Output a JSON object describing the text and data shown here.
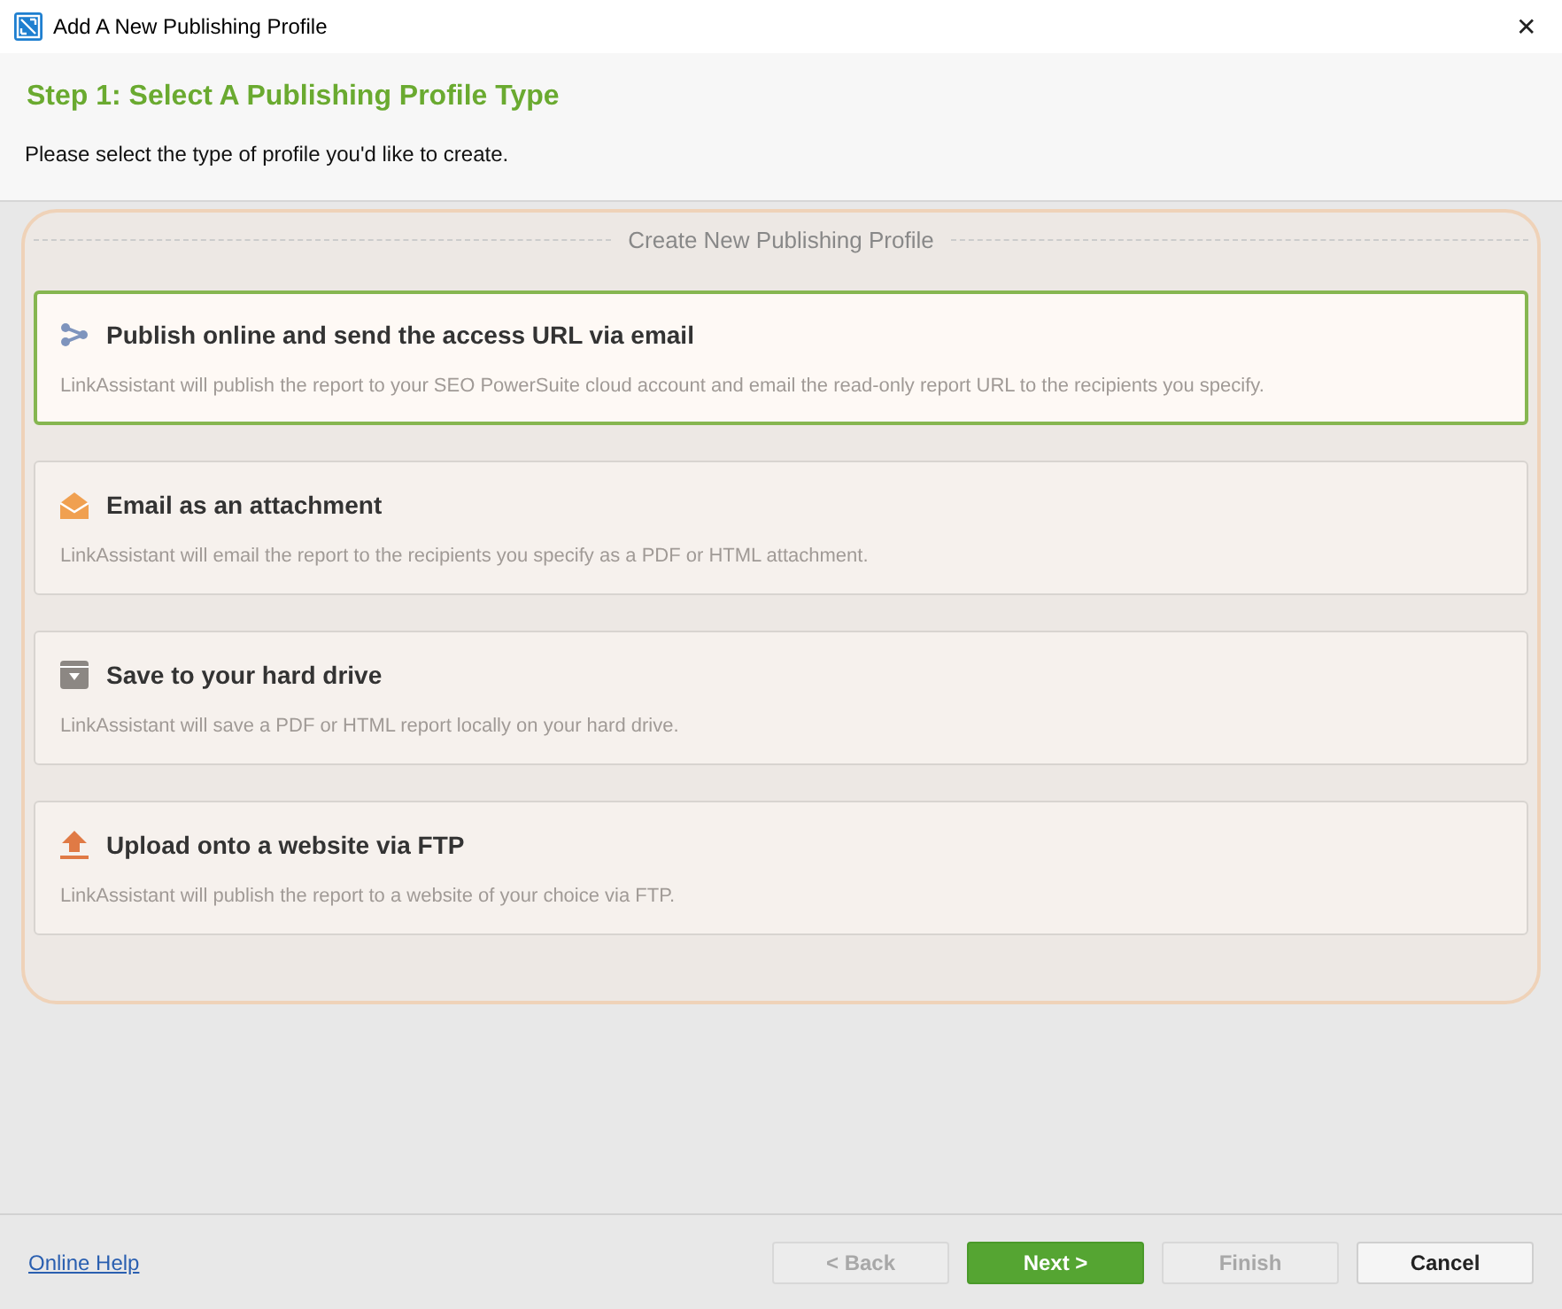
{
  "window": {
    "title": "Add A New Publishing Profile",
    "close": "✕"
  },
  "header": {
    "title": "Step 1: Select A Publishing Profile Type",
    "subtitle": "Please select the type of profile you'd like to create."
  },
  "group": {
    "legend": "Create New Publishing Profile",
    "options": [
      {
        "kind": "share",
        "title": "Publish online and send the access URL via email",
        "description": "LinkAssistant will publish the report to your SEO PowerSuite cloud account and email the read-only report URL to the recipients you specify.",
        "selected": true
      },
      {
        "kind": "email",
        "title": "Email as an attachment",
        "description": "LinkAssistant will email the report to the recipients you specify as a PDF or HTML attachment.",
        "selected": false
      },
      {
        "kind": "drive",
        "title": "Save to your hard drive",
        "description": "LinkAssistant will save a PDF or HTML report locally on your hard drive.",
        "selected": false
      },
      {
        "kind": "upload",
        "title": "Upload onto a website via FTP",
        "description": "LinkAssistant will publish the report to a website of your choice via FTP.",
        "selected": false
      }
    ]
  },
  "footer": {
    "help_link": "Online Help",
    "buttons": [
      {
        "kind": "normal",
        "label": "< Back",
        "disabled": true
      },
      {
        "kind": "primary",
        "label": "Next >",
        "disabled": false
      },
      {
        "kind": "normal",
        "label": "Finish",
        "disabled": true
      },
      {
        "kind": "normal",
        "label": "Cancel",
        "disabled": false
      }
    ]
  }
}
